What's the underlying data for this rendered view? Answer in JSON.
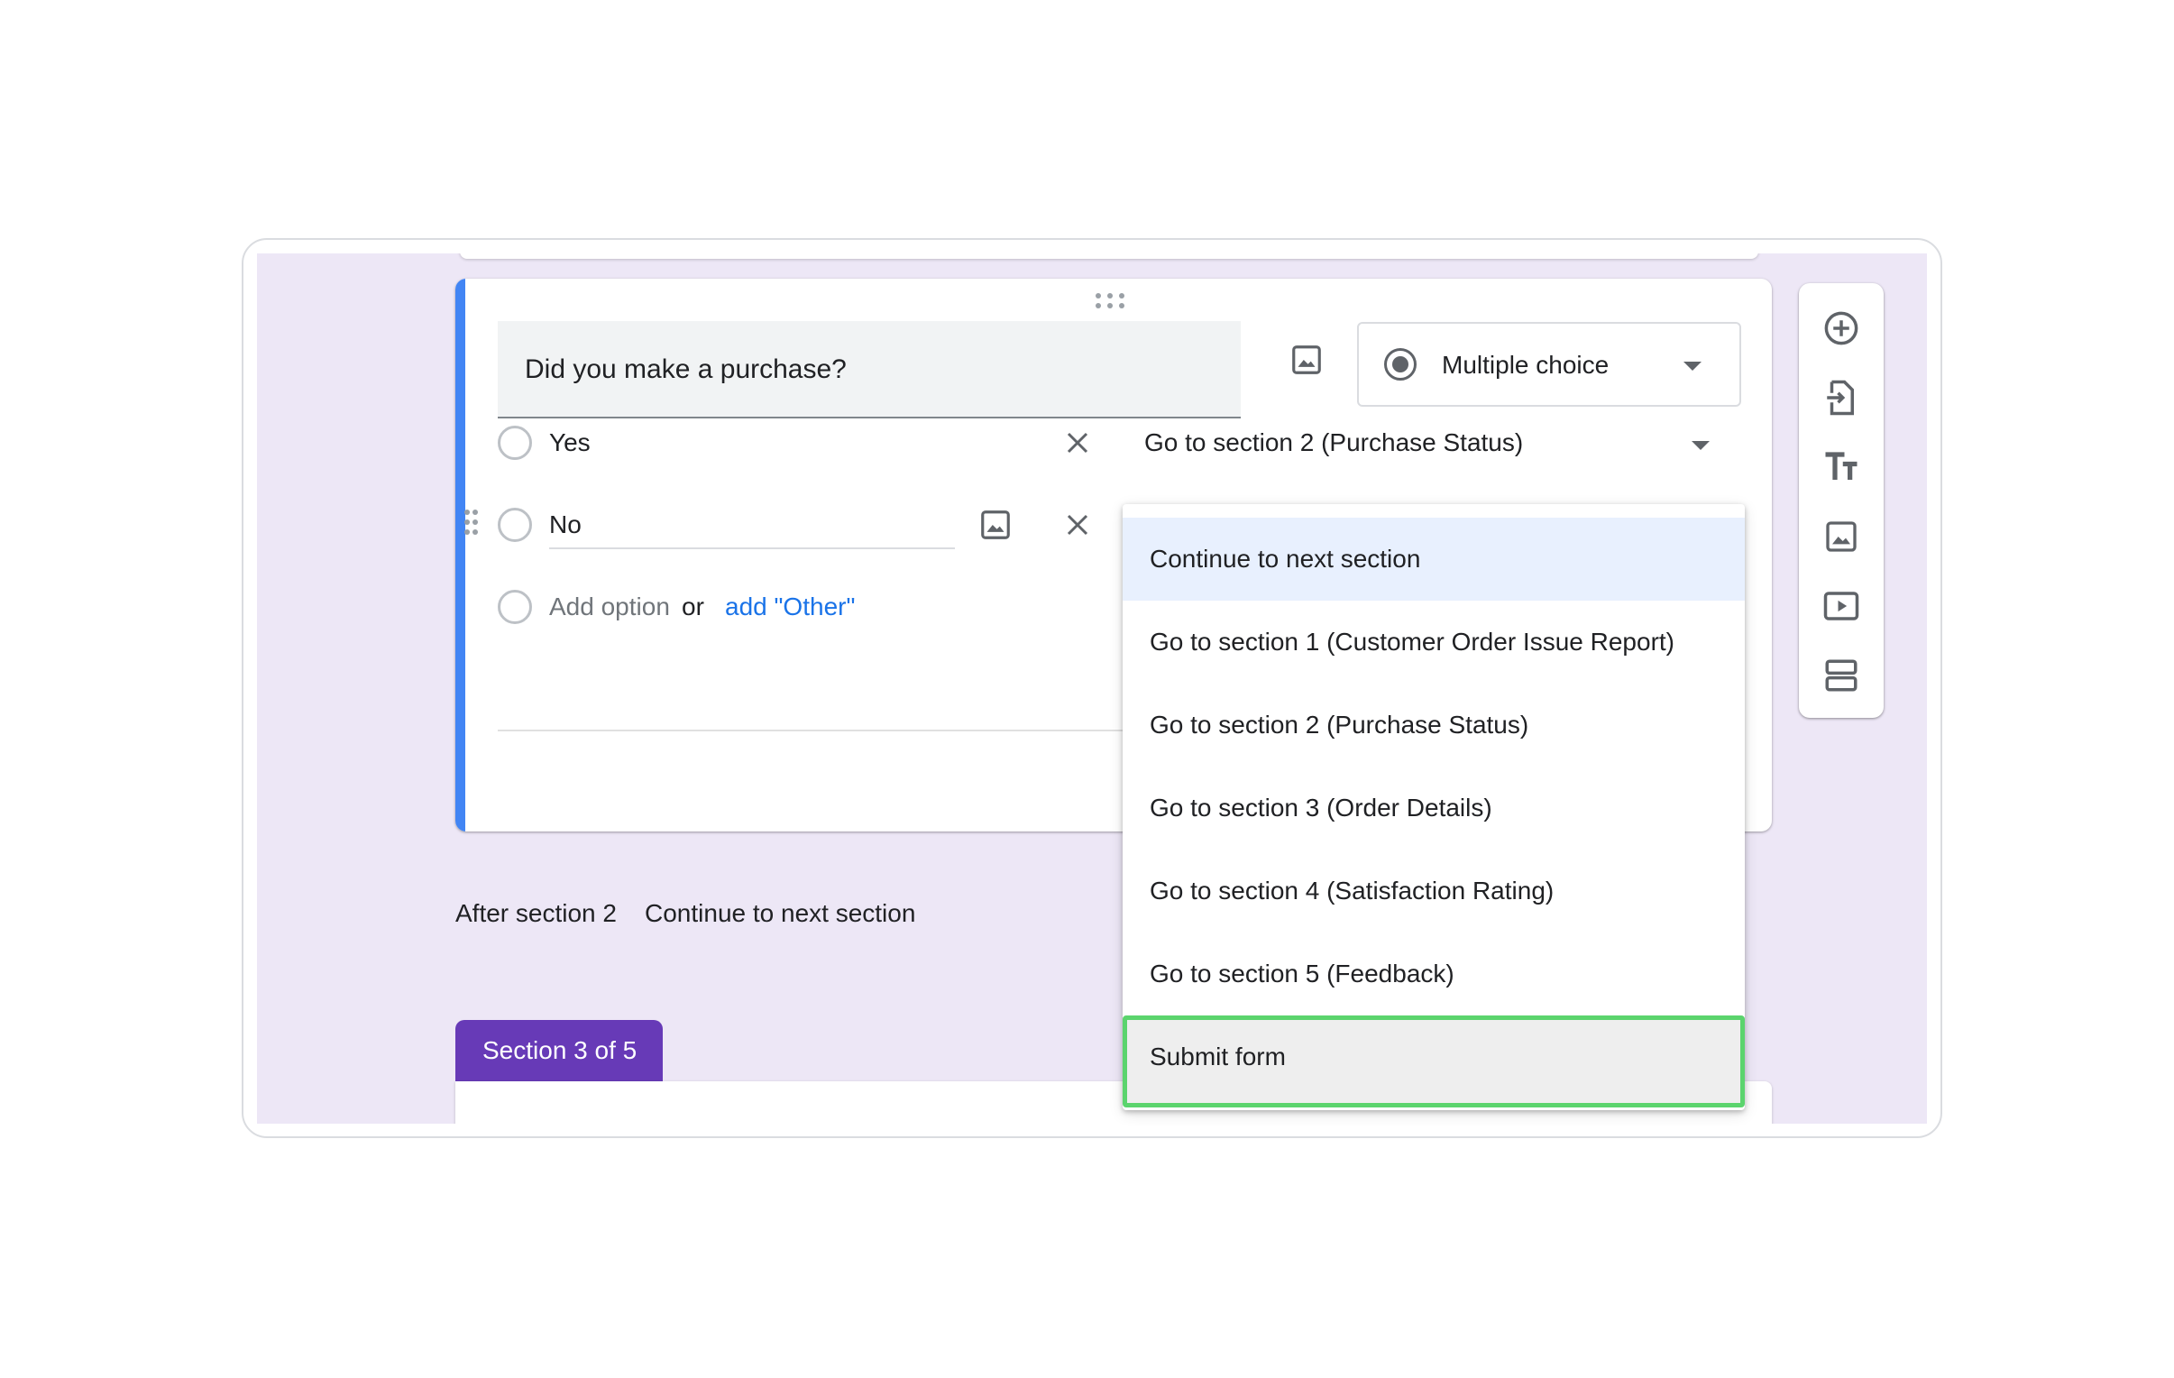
{
  "question": {
    "title": "Did you make a purchase?",
    "type_label": "Multiple choice",
    "options": [
      {
        "label": "Yes",
        "goto": "Go to section 2 (Purchase Status)"
      },
      {
        "label": "No"
      }
    ],
    "add_option": "Add option",
    "or_text": "or",
    "add_other": "add \"Other\""
  },
  "section_nav": {
    "after_label": "After section 2",
    "after_value": "Continue to next section"
  },
  "next_section_tab": "Section 3 of 5",
  "dropdown": {
    "items": [
      "Continue to next section",
      "Go to section 1 (Customer Order Issue Report)",
      "Go to section 2 (Purchase Status)",
      "Go to section 3 (Order Details)",
      "Go to section 4 (Satisfaction Rating)",
      "Go to section 5 (Feedback)",
      "Submit form"
    ],
    "selected_index": 0,
    "highlighted_index": 6
  },
  "toolbar": {
    "tools": [
      "add-question-icon",
      "import-questions-icon",
      "add-title-icon",
      "add-image-icon",
      "add-video-icon",
      "add-section-icon"
    ]
  },
  "colors": {
    "accent": "#4285f4",
    "section_tab": "#673ab7",
    "canvas_bg": "#ede7f6",
    "link": "#1a73e8",
    "highlight_border": "#5bd46d"
  }
}
